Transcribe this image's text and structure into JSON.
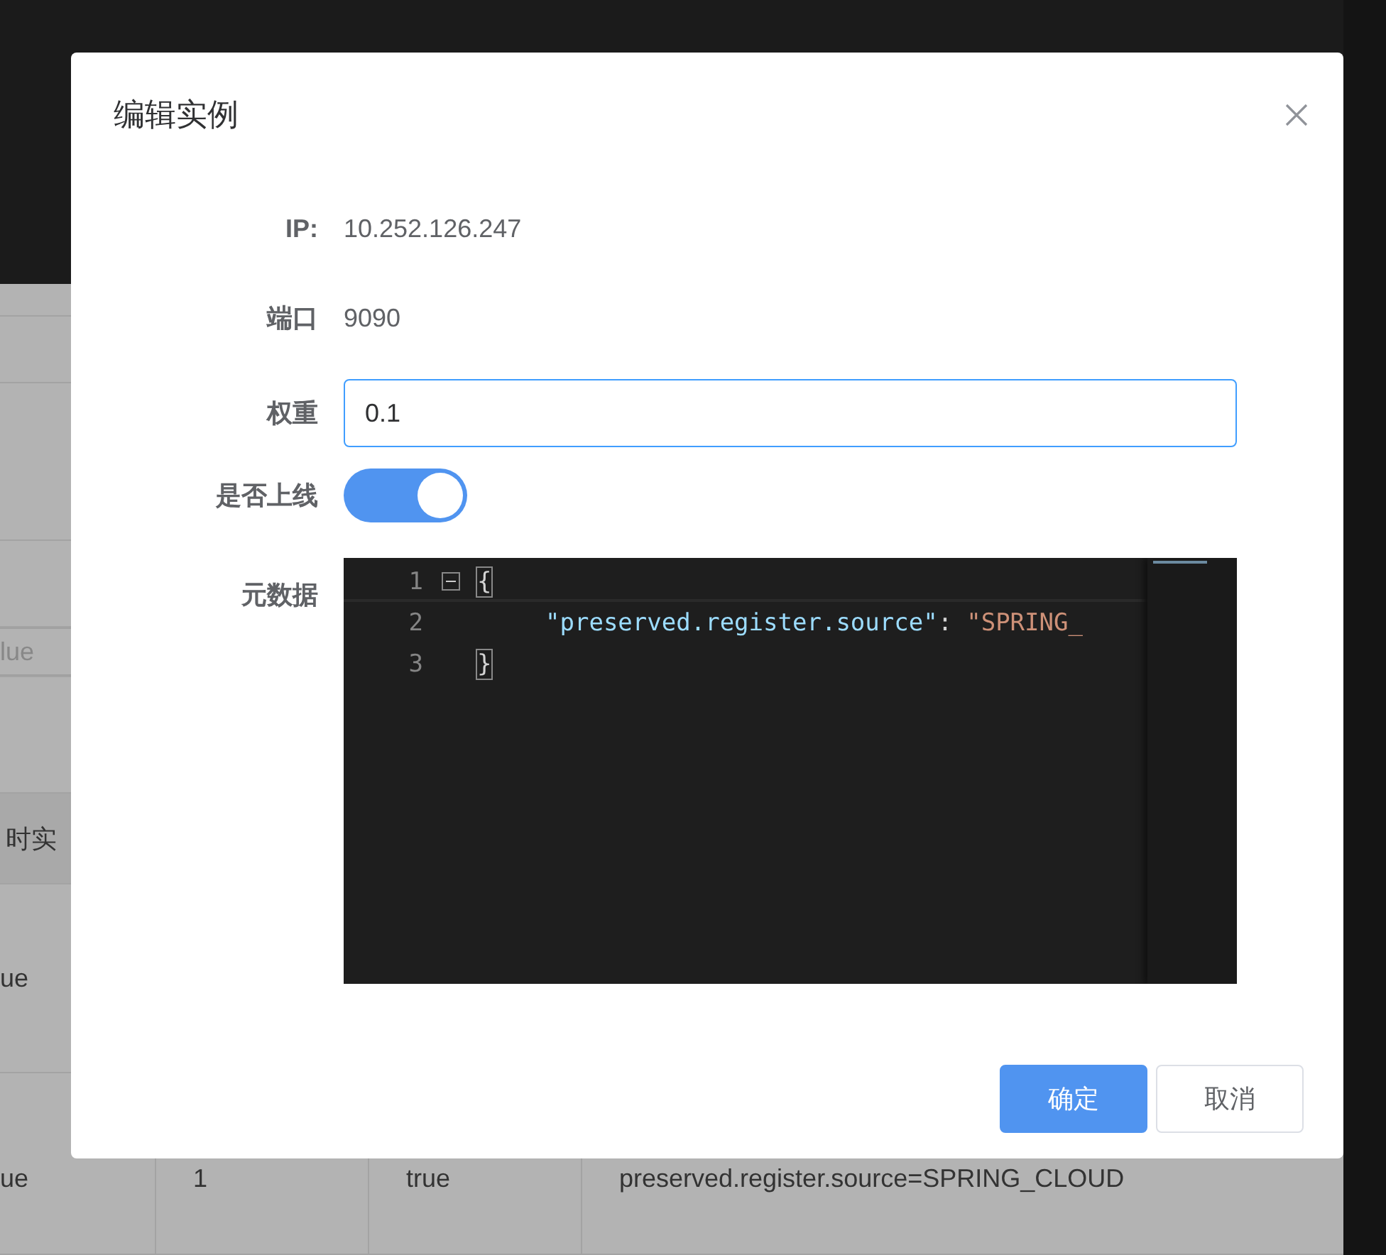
{
  "background": {
    "field_placeholder": "lue",
    "header_cell": "时实",
    "rows": [
      {
        "cells": [
          "ue"
        ]
      },
      {
        "cells": [
          "ue",
          "1",
          "true",
          "preserved.register.source=SPRING_CLOUD"
        ]
      }
    ]
  },
  "dialog": {
    "title": "编辑实例",
    "fields": [
      {
        "kind": "text",
        "label": "IP:",
        "value": "10.252.126.247"
      },
      {
        "kind": "text",
        "label": "端口",
        "value": "9090"
      },
      {
        "kind": "input",
        "label": "权重",
        "value": "0.1"
      },
      {
        "kind": "switch",
        "label": "是否上线",
        "on": true
      },
      {
        "kind": "code",
        "label": "元数据",
        "lines": [
          {
            "number": "1",
            "foldable": true,
            "tokens": [
              {
                "kind": "brace",
                "text": "{"
              }
            ],
            "children": [
              {
                "number": "2",
                "foldable": false,
                "tokens": [
                  {
                    "kind": "key",
                    "text": "\"preserved.register.source\""
                  },
                  {
                    "kind": "punct",
                    "text": ":"
                  },
                  {
                    "kind": "string",
                    "text": "\"SPRING_"
                  }
                ]
              }
            ]
          },
          {
            "number": "3",
            "foldable": false,
            "tokens": [
              {
                "kind": "brace",
                "text": "}"
              }
            ]
          }
        ]
      }
    ],
    "buttons": [
      {
        "kind": "primary",
        "label": "确定"
      },
      {
        "kind": "default",
        "label": "取消"
      }
    ]
  }
}
